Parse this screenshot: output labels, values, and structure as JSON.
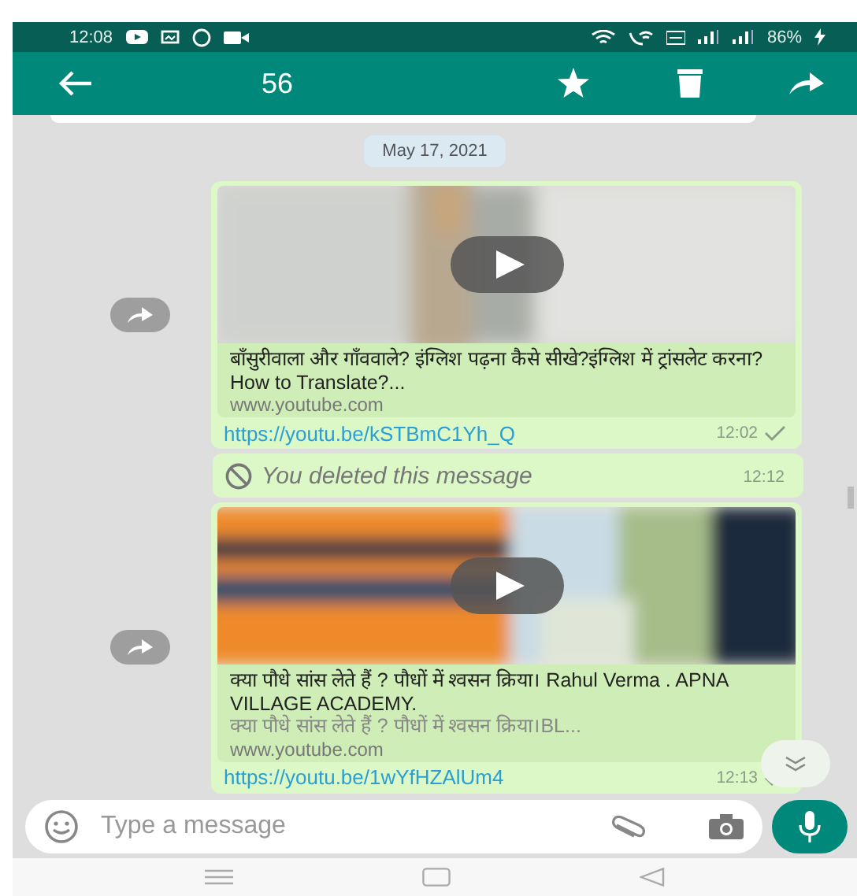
{
  "status_bar": {
    "time": "12:08",
    "battery": "86%"
  },
  "app_bar": {
    "title": "56"
  },
  "date_chip": "May 17, 2021",
  "messages": [
    {
      "kind": "link",
      "title": "बाँसुरीवाला और गाँववाले? इंग्लिश पढ़ना कैसे सीखे?इंग्लिश में ट्रांसलेट करना?How to Translate?...",
      "site": "www.youtube.com",
      "url": "https://youtu.be/kSTBmC1Yh_Q",
      "time": "12:02"
    },
    {
      "kind": "deleted",
      "text": "You deleted this message",
      "time": "12:12"
    },
    {
      "kind": "link",
      "title": "क्या पौधे सांस लेते हैं ? पौधों में श्वसन क्रिया। Rahul Verma . APNA VILLAGE ACADEMY.",
      "description": "क्या पौधे सांस लेते हैं ? पौधों में श्वसन क्रिया।BL...",
      "site": "www.youtube.com",
      "url": "https://youtu.be/1wYfHZAlUm4",
      "time": "12:13"
    }
  ],
  "composer": {
    "placeholder": "Type a message"
  }
}
